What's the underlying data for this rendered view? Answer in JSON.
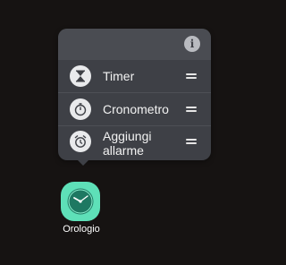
{
  "popup": {
    "info_icon": "info-icon",
    "items": [
      {
        "label": "Timer",
        "icon": "hourglass-icon"
      },
      {
        "label": "Cronometro",
        "icon": "stopwatch-icon"
      },
      {
        "label": "Aggiungi\nallarme",
        "icon": "alarm-clock-icon"
      }
    ]
  },
  "app": {
    "label": "Orologio",
    "icon": "clock-icon"
  },
  "colors": {
    "background": "#161312",
    "popup": "#3e4046",
    "popup_header": "#4a4c52",
    "app_icon": "#5ee0b8",
    "clock_face": "#1e7862"
  }
}
